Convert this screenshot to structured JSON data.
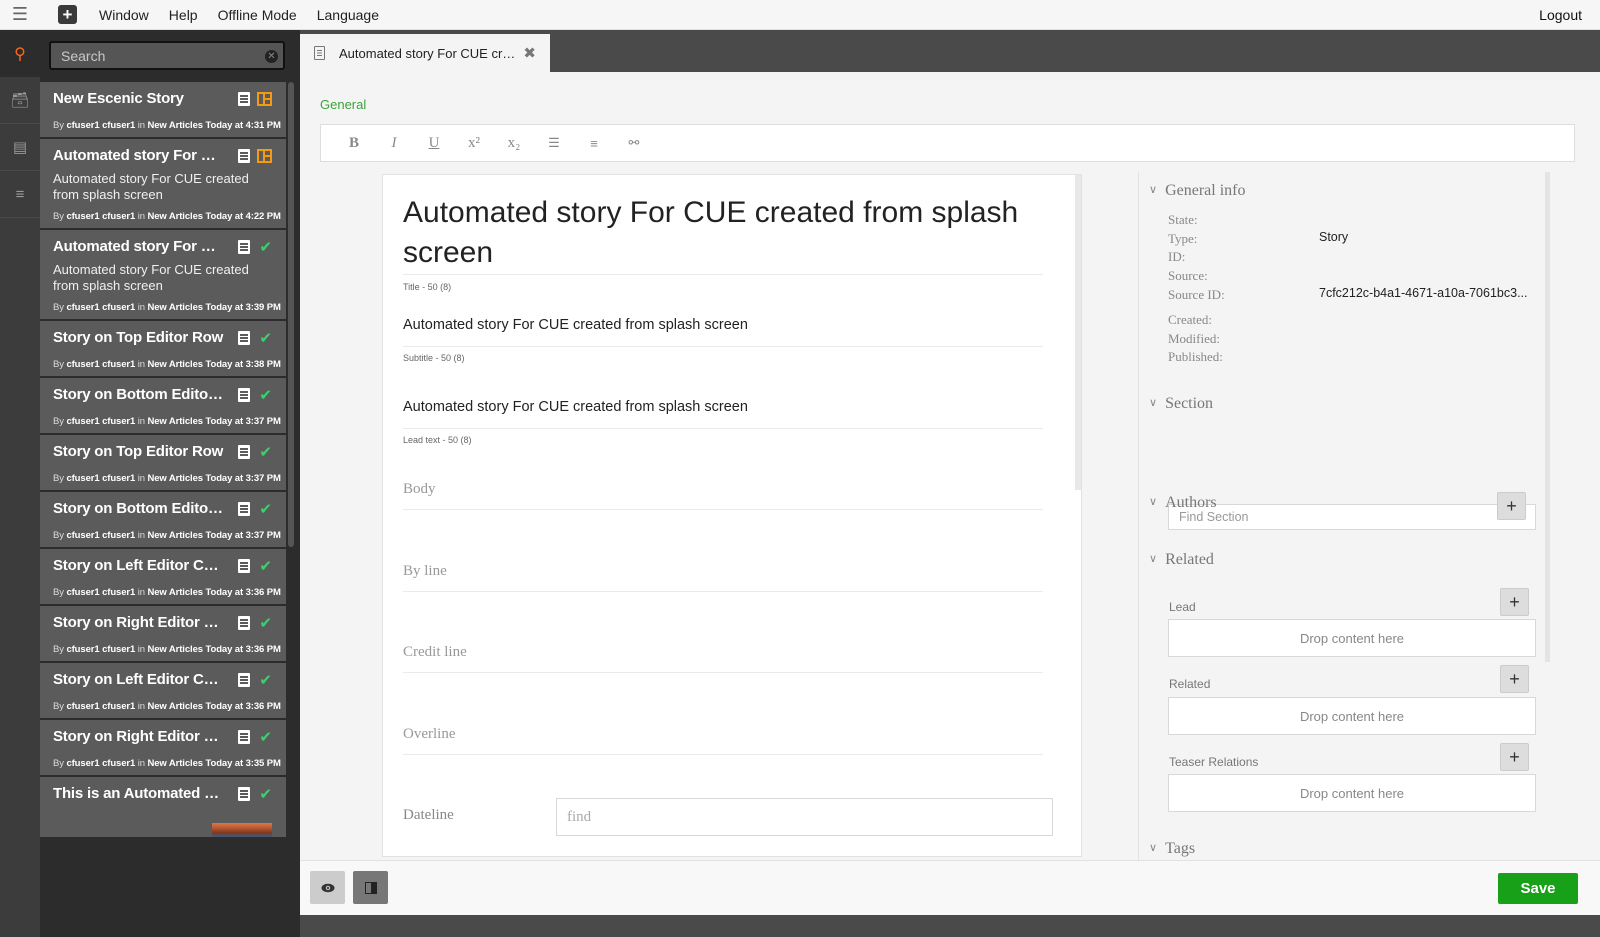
{
  "menubar": {
    "items": [
      "Window",
      "Help",
      "Offline Mode",
      "Language"
    ],
    "logout": "Logout"
  },
  "search": {
    "placeholder": "Search"
  },
  "results": [
    {
      "title": "New Escenic Story",
      "desc": "",
      "user": "cfuser1 cfuser1",
      "in": "in",
      "by": "By",
      "section": "New Articles",
      "time": "Today at 4:31 PM",
      "status": "layout"
    },
    {
      "title": "Automated story For CUE created from splash screen",
      "desc": "Automated story For CUE created from splash screen",
      "user": "cfuser1 cfuser1",
      "in": "in",
      "by": "By",
      "section": "New Articles",
      "time": "Today at 4:22 PM",
      "status": "layout"
    },
    {
      "title": "Automated story For CUE created from splash screen",
      "desc": "Automated story For CUE created from splash screen",
      "user": "cfuser1 cfuser1",
      "in": "in",
      "by": "By",
      "section": "New Articles",
      "time": "Today at 3:39 PM",
      "status": "published"
    },
    {
      "title": "Story on Top Editor Row",
      "desc": "",
      "user": "cfuser1 cfuser1",
      "in": "in",
      "by": "By",
      "section": "New Articles",
      "time": "Today at 3:38 PM",
      "status": "published"
    },
    {
      "title": "Story on Bottom Editor Row",
      "desc": "",
      "user": "cfuser1 cfuser1",
      "in": "in",
      "by": "By",
      "section": "New Articles",
      "time": "Today at 3:37 PM",
      "status": "published"
    },
    {
      "title": "Story on Top Editor Row",
      "desc": "",
      "user": "cfuser1 cfuser1",
      "in": "in",
      "by": "By",
      "section": "New Articles",
      "time": "Today at 3:37 PM",
      "status": "published"
    },
    {
      "title": "Story on Bottom Editor Row",
      "desc": "",
      "user": "cfuser1 cfuser1",
      "in": "in",
      "by": "By",
      "section": "New Articles",
      "time": "Today at 3:37 PM",
      "status": "published"
    },
    {
      "title": "Story on Left Editor Column",
      "desc": "",
      "user": "cfuser1 cfuser1",
      "in": "in",
      "by": "By",
      "section": "New Articles",
      "time": "Today at 3:36 PM",
      "status": "published"
    },
    {
      "title": "Story on Right Editor Column",
      "desc": "",
      "user": "cfuser1 cfuser1",
      "in": "in",
      "by": "By",
      "section": "New Articles",
      "time": "Today at 3:36 PM",
      "status": "published"
    },
    {
      "title": "Story on Left Editor Column",
      "desc": "",
      "user": "cfuser1 cfuser1",
      "in": "in",
      "by": "By",
      "section": "New Articles",
      "time": "Today at 3:36 PM",
      "status": "published"
    },
    {
      "title": "Story on Right Editor Column",
      "desc": "",
      "user": "cfuser1 cfuser1",
      "in": "in",
      "by": "By",
      "section": "New Articles",
      "time": "Today at 3:35 PM",
      "status": "published"
    },
    {
      "title": "This is an Automated story",
      "desc": "",
      "user": "",
      "in": "",
      "by": "",
      "section": "",
      "time": "",
      "status": "published",
      "thumb": true
    }
  ],
  "tab": {
    "label": "Automated story For CUE created from splash screen"
  },
  "editor": {
    "general_label": "General",
    "toolbar": {
      "bold": "B",
      "italic": "I",
      "underline": "U",
      "superscript": "x²",
      "subscript": "x₂",
      "bullet_list": "☰",
      "numbered_list": "≡",
      "link": "⚯"
    },
    "fields": {
      "title": {
        "value": "Automated story For CUE created from splash screen",
        "hint": "Title - 50 (8)"
      },
      "subtitle": {
        "value": "Automated story For CUE created from splash screen",
        "hint": "Subtitle - 50 (8)"
      },
      "lead": {
        "value": "Automated story For CUE created from splash screen",
        "hint": "Lead text - 50 (8)"
      },
      "body": {
        "placeholder": "Body"
      },
      "byline": {
        "placeholder": "By line"
      },
      "creditline": {
        "placeholder": "Credit line"
      },
      "overline": {
        "placeholder": "Overline"
      },
      "dateline": {
        "label": "Dateline",
        "placeholder": "find"
      }
    }
  },
  "sidebar": {
    "general_info": {
      "heading": "General info",
      "state_label": "State:",
      "type_label": "Type:",
      "type_value": "Story",
      "id_label": "ID:",
      "source_label": "Source:",
      "source_id_label": "Source ID:",
      "source_id_value": "7cfc212c-b4a1-4671-a10a-7061bc3...",
      "created_label": "Created:",
      "modified_label": "Modified:",
      "published_label": "Published:"
    },
    "section": {
      "heading": "Section",
      "placeholder": "Find Section"
    },
    "authors": {
      "heading": "Authors"
    },
    "related": {
      "heading": "Related",
      "lead_label": "Lead",
      "related_label": "Related",
      "teaser_label": "Teaser Relations",
      "drop_text": "Drop content here"
    },
    "tags": {
      "heading": "Tags"
    }
  },
  "footer": {
    "save": "Save"
  }
}
